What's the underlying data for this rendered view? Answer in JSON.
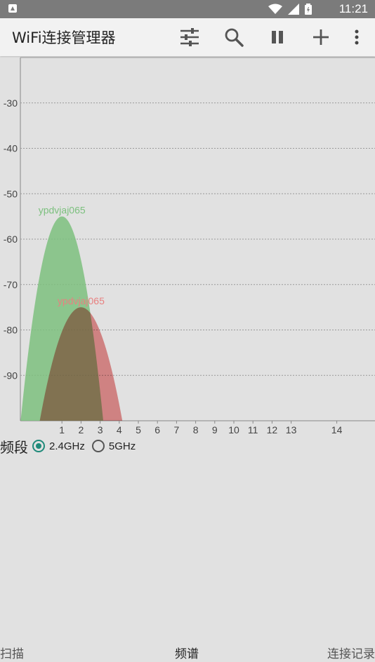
{
  "status_bar": {
    "time": "11:21",
    "icons": [
      "app-notification-icon",
      "wifi-icon",
      "signal-icon",
      "battery-icon"
    ]
  },
  "toolbar": {
    "title": "WiFi连接管理器",
    "actions": [
      "filter-icon",
      "search-icon",
      "pause-icon",
      "add-icon",
      "more-vert-icon"
    ]
  },
  "chart_data": {
    "type": "area",
    "ylabel": "",
    "xlabel": "",
    "ylim": [
      -100,
      -20
    ],
    "y_ticks": [
      "-30",
      "-40",
      "-50",
      "-60",
      "-70",
      "-80",
      "-90"
    ],
    "x_ticks": [
      "1",
      "2",
      "3",
      "4",
      "5",
      "6",
      "7",
      "8",
      "9",
      "10",
      "11",
      "12",
      "13",
      "14"
    ],
    "grid": true,
    "series": [
      {
        "name": "ypdvjaj065",
        "channel": 1,
        "signal": -55,
        "color": "#7cc07e"
      },
      {
        "name": "ypdvjaj065",
        "channel": 2,
        "signal": -75,
        "color": "#e88080"
      }
    ]
  },
  "band_selector": {
    "label": "频段",
    "options": [
      {
        "label": "2.4GHz",
        "selected": true
      },
      {
        "label": "5GHz",
        "selected": false
      }
    ]
  },
  "bottom_nav": {
    "tabs": [
      "扫描",
      "频谱",
      "连接记录"
    ],
    "active": "频谱"
  }
}
